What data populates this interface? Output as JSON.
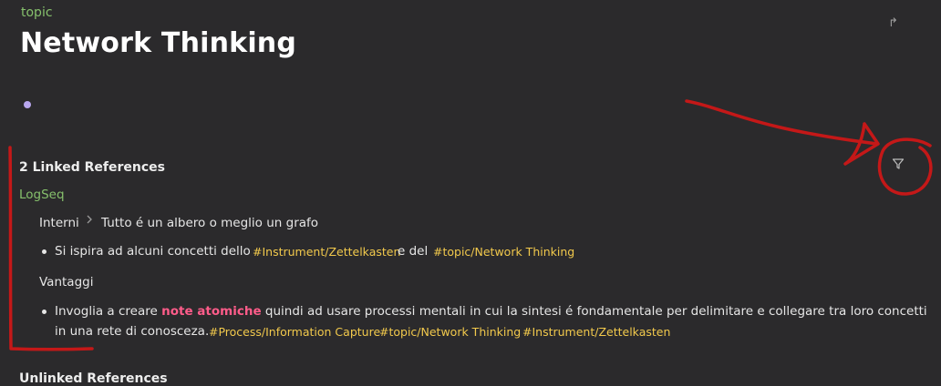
{
  "page": {
    "type_label": "topic",
    "title": "Network Thinking"
  },
  "linked_refs": {
    "heading": "2 Linked References",
    "page_name": "LogSeq",
    "breadcrumb": [
      "Interni",
      "Tutto é un albero o meglio un grafo"
    ],
    "block1": {
      "text1": "Si ispira ad alcuni concetti dello",
      "tag1": "#Instrument/Zettelkasten",
      "text2": "e del",
      "tag2": "#topic/Network Thinking"
    },
    "section2": "Vantaggi",
    "block2": {
      "text1": "Invoglia a creare",
      "highlight": "note atomiche",
      "text2": "quindi ad usare processi mentali in cui la sintesi é fondamentale per delimitare e collegare tra loro concetti",
      "line2": "in una rete di conosceza.",
      "tag1": "#Process/Information Capture",
      "tag2": "#topic/Network Thinking",
      "tag3": "#Instrument/Zettelkasten"
    }
  },
  "unlinked_refs": {
    "heading": "Unlinked References"
  },
  "icons": {
    "share": "share-icon",
    "filter": "filter-icon",
    "chevron": "chevron-right-icon"
  },
  "colors": {
    "background": "#2b2a2c",
    "page_link": "#86c06c",
    "tag": "#f2c94c",
    "highlight": "#ff5c8a",
    "bullet_accent": "#b9a7ef",
    "annotation": "#c41818"
  }
}
